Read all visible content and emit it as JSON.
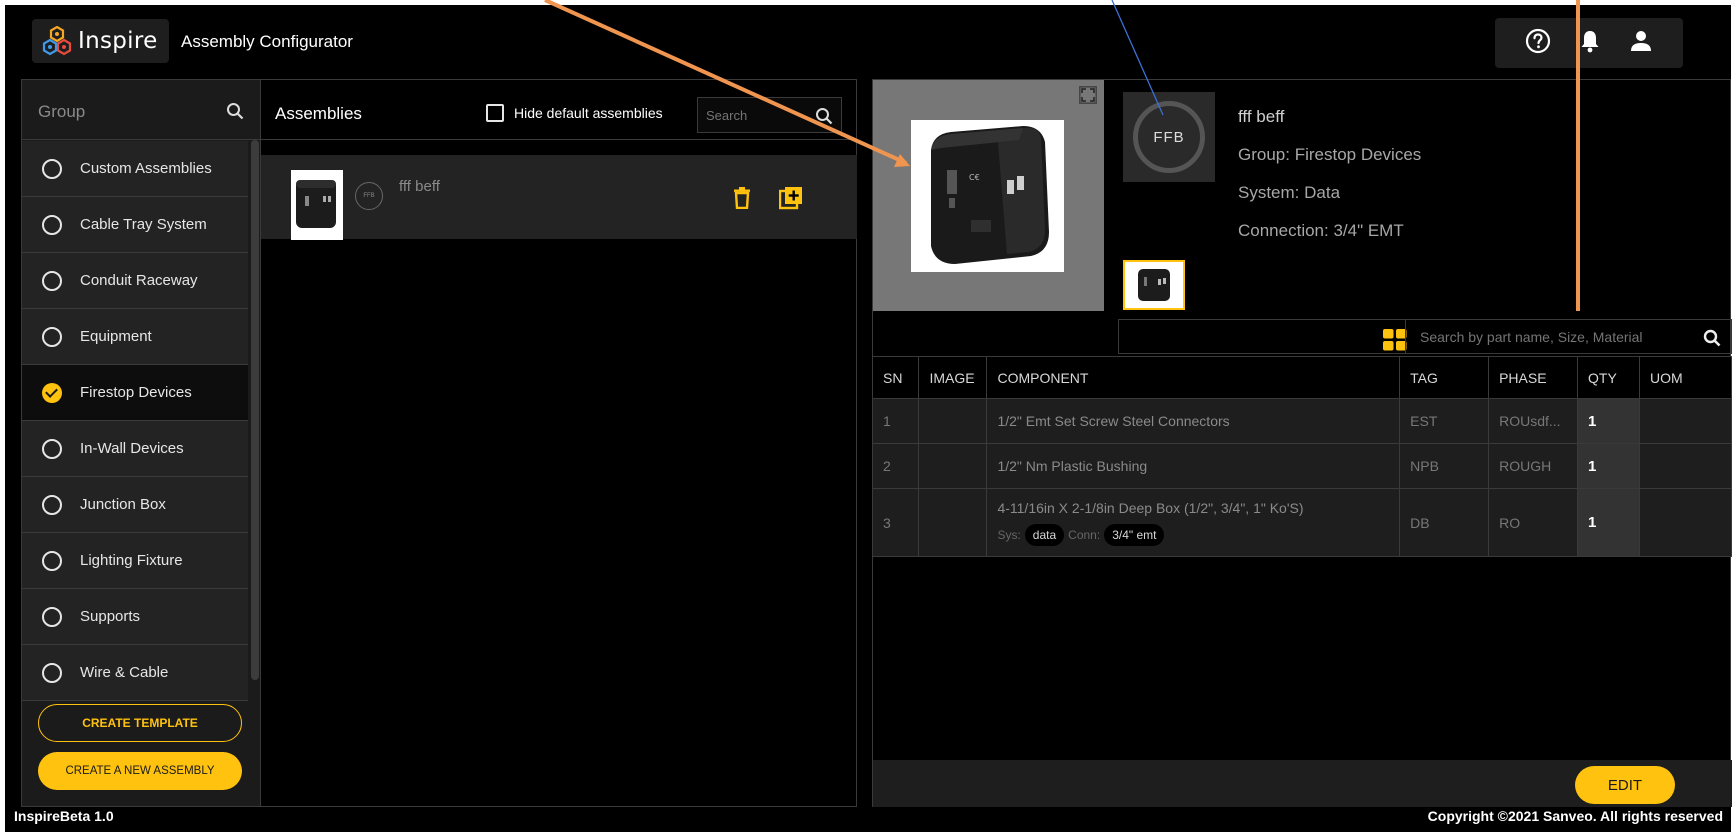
{
  "header": {
    "logo_text": "Inspire",
    "app_title": "Assembly Configurator",
    "icons": [
      "help-icon",
      "bell-icon",
      "user-icon"
    ]
  },
  "groups": {
    "header_label": "Group",
    "items": [
      {
        "label": "Custom Assemblies",
        "selected": false
      },
      {
        "label": "Cable Tray System",
        "selected": false
      },
      {
        "label": "Conduit Raceway",
        "selected": false
      },
      {
        "label": "Equipment",
        "selected": false
      },
      {
        "label": "Firestop Devices",
        "selected": true
      },
      {
        "label": "In-Wall Devices",
        "selected": false
      },
      {
        "label": "Junction Box",
        "selected": false
      },
      {
        "label": "Lighting Fixture",
        "selected": false
      },
      {
        "label": "Supports",
        "selected": false
      },
      {
        "label": "Wire & Cable",
        "selected": false
      }
    ],
    "create_template_label": "CREATE TEMPLATE",
    "create_assembly_label": "CREATE A NEW ASSEMBLY"
  },
  "assemblies": {
    "title": "Assemblies",
    "hide_default_label": "Hide default assemblies",
    "search_placeholder": "Search",
    "items": [
      {
        "name": "fff beff",
        "badge": "FFB"
      }
    ]
  },
  "detail": {
    "badge": "FFB",
    "name": "fff beff",
    "group": "Group: Firestop Devices",
    "system": "System: Data",
    "connection": "Connection: 3/4\" EMT",
    "search_placeholder": "Search by part name, Size, Material",
    "columns": [
      "SN",
      "IMAGE",
      "COMPONENT",
      "TAG",
      "PHASE",
      "QTY",
      "UOM"
    ],
    "rows": [
      {
        "sn": "1",
        "component": "1/2\" Emt Set Screw Steel Connectors",
        "tag": "EST",
        "phase": "ROUsdf...",
        "qty": "1"
      },
      {
        "sn": "2",
        "component": "1/2\" Nm Plastic Bushing",
        "tag": "NPB",
        "phase": "ROUGH",
        "qty": "1"
      },
      {
        "sn": "3",
        "component": "4-11/16in X 2-1/8in Deep Box (1/2\", 3/4\", 1\" Ko'S)",
        "tag": "DB",
        "phase": "RO",
        "qty": "1",
        "sys_label": "Sys:",
        "sys_value": "data",
        "conn_label": "Conn:",
        "conn_value": "3/4\" emt"
      }
    ],
    "edit_label": "EDIT"
  },
  "footer": {
    "version": "InspireBeta 1.0",
    "copyright": "Copyright ©2021 Sanveo. All rights reserved"
  },
  "colors": {
    "accent": "#ffc20e",
    "annotation_orange": "#f0954f",
    "annotation_blue": "#3d6fd6"
  }
}
